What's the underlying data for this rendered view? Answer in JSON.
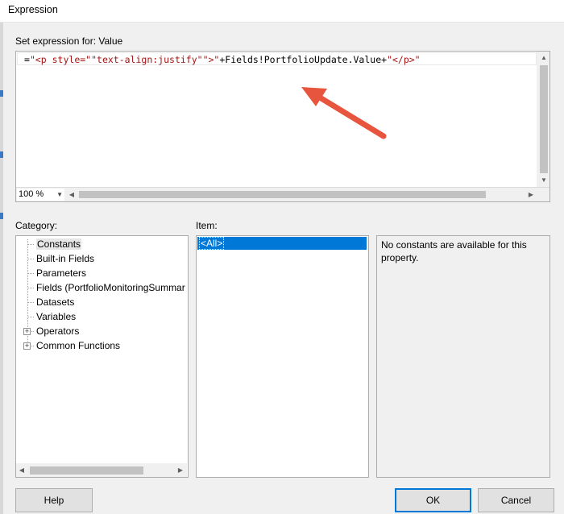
{
  "window": {
    "title": "Expression"
  },
  "labels": {
    "set_expression": "Set expression for: Value",
    "category": "Category:",
    "item": "Item:"
  },
  "editor": {
    "expr_prefix": "=",
    "expr_str1": "\"<p style=\"\"text-align:justify\"\">\"",
    "expr_mid": "+Fields!PortfolioUpdate.Value+",
    "expr_str2": "\"</p>\"",
    "zoom": "100 %"
  },
  "category": {
    "items": [
      {
        "label": "Constants",
        "selected": true,
        "expandable": false
      },
      {
        "label": "Built-in Fields",
        "expandable": false
      },
      {
        "label": "Parameters",
        "expandable": false
      },
      {
        "label": "Fields (PortfolioMonitoringSummar",
        "expandable": false
      },
      {
        "label": "Datasets",
        "expandable": false
      },
      {
        "label": "Variables",
        "expandable": false
      },
      {
        "label": "Operators",
        "expandable": true
      },
      {
        "label": "Common Functions",
        "expandable": true
      }
    ]
  },
  "item": {
    "selected": "<All>"
  },
  "description": {
    "text": "No constants are available for this property."
  },
  "buttons": {
    "help": "Help",
    "ok": "OK",
    "cancel": "Cancel"
  },
  "colors": {
    "accent": "#0078d7",
    "annotation_arrow": "#e8553e",
    "string_literal": "#a31515"
  },
  "icons": {
    "annotation": "red-arrow-annotation"
  }
}
